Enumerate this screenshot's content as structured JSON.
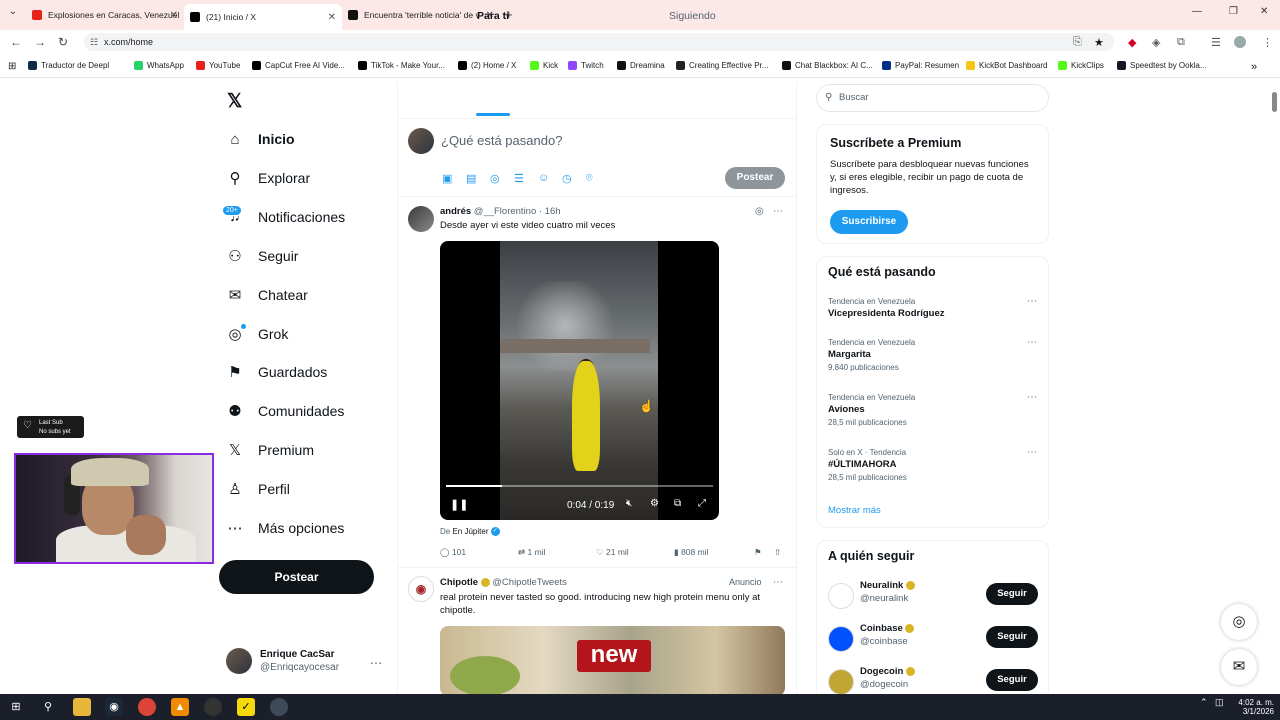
{
  "browser": {
    "tabs": [
      {
        "title": "Explosiones en Caracas, Venezuel",
        "color": "#e62117",
        "active": false
      },
      {
        "title": "(21) Inicio / X",
        "color": "#000000",
        "active": true
      },
      {
        "title": "Encuentra 'terrible noticia' de v",
        "color": "#111111",
        "active": false
      }
    ],
    "url": "x.com/home",
    "bookmarks": [
      {
        "label": "Traductor de Deepl",
        "color": "#0f2b46"
      },
      {
        "label": "WhatsApp",
        "color": "#25d366"
      },
      {
        "label": "YouTube",
        "color": "#e62117"
      },
      {
        "label": "CapCut Free AI Vide...",
        "color": "#000000"
      },
      {
        "label": "TikTok - Make Your...",
        "color": "#000000"
      },
      {
        "label": "(2) Home / X",
        "color": "#000000"
      },
      {
        "label": "Kick",
        "color": "#53fc18"
      },
      {
        "label": "Twitch",
        "color": "#9146ff"
      },
      {
        "label": "Dreamina",
        "color": "#111111"
      },
      {
        "label": "Creating Effective Pr...",
        "color": "#222222"
      },
      {
        "label": "Chat Blackbox: AI C...",
        "color": "#111111"
      },
      {
        "label": "PayPal: Resumen",
        "color": "#003087"
      },
      {
        "label": "KickBot Dashboard",
        "color": "#f5c518"
      },
      {
        "label": "KickClips",
        "color": "#53fc18"
      },
      {
        "label": "Speedtest by Ookla...",
        "color": "#141526"
      }
    ]
  },
  "nav": {
    "items": [
      {
        "label": "Inicio",
        "icon": "home-icon",
        "glyph": "⌂"
      },
      {
        "label": "Explorar",
        "icon": "search-icon",
        "glyph": "⚲"
      },
      {
        "label": "Notificaciones",
        "icon": "bell-icon",
        "glyph": "♫"
      },
      {
        "label": "Seguir",
        "icon": "add-user-icon",
        "glyph": "⚇"
      },
      {
        "label": "Chatear",
        "icon": "mail-icon",
        "glyph": "✉"
      },
      {
        "label": "Grok",
        "icon": "grok-icon",
        "glyph": "◎"
      },
      {
        "label": "Guardados",
        "icon": "bookmark-icon",
        "glyph": "⚑"
      },
      {
        "label": "Comunidades",
        "icon": "communities-icon",
        "glyph": "⚉"
      },
      {
        "label": "Premium",
        "icon": "x-logo-icon",
        "glyph": "𝕏"
      },
      {
        "label": "Perfil",
        "icon": "profile-icon",
        "glyph": "♙"
      },
      {
        "label": "Más opciones",
        "icon": "more-options-icon",
        "glyph": "⋯"
      }
    ],
    "notif_badge": "20+",
    "post_button": "Postear",
    "account": {
      "name": "Enrique CacSar",
      "handle": "@Enriqcayocesar"
    }
  },
  "overlay": {
    "last_sub_title": "Last Sub",
    "last_sub_value": "No subs yet"
  },
  "feed": {
    "tabs": [
      "Para ti",
      "Siguiendo"
    ],
    "compose_placeholder": "¿Qué está pasando?",
    "compose_post": "Postear",
    "tweet": {
      "name": "andrés",
      "handle": "@__Florentino",
      "time": "16h",
      "text": "Desde ayer vi este video cuatro mil veces",
      "video_time": "0:04 / 0:19",
      "video_progress": 0.21,
      "via_prefix": "De",
      "via_source": "En Júpiter",
      "replies": "101",
      "reposts": "1 mil",
      "likes": "21 mil",
      "views": "808 mil"
    },
    "ad": {
      "name": "Chipotle",
      "handle": "@ChipotleTweets",
      "label": "Anuncio",
      "text": "real protein never tasted so good. introducing new high protein menu only at chipotle.",
      "image_tag": "new"
    }
  },
  "sidebar": {
    "search_placeholder": "Buscar",
    "premium": {
      "title": "Suscríbete a Premium",
      "text": "Suscríbete para desbloquear nuevas funciones y, si eres elegible, recibir un pago de cuota de ingresos.",
      "button": "Suscribirse"
    },
    "trends_title": "Qué está pasando",
    "trends": [
      {
        "context": "Tendencia en Venezuela",
        "title": "Vicepresidenta Rodríguez",
        "count": ""
      },
      {
        "context": "Tendencia en Venezuela",
        "title": "Margarita",
        "count": "9.840 publicaciones"
      },
      {
        "context": "Tendencia en Venezuela",
        "title": "Aviones",
        "count": "28,5 mil publicaciones"
      },
      {
        "context": "Solo en X · Tendencia",
        "title": "#ÚLTIMAHORA",
        "count": "28,5 mil publicaciones"
      }
    ],
    "show_more": "Mostrar más",
    "follow_title": "A quién seguir",
    "follow": [
      {
        "name": "Neuralink",
        "handle": "@neuralink",
        "button": "Seguir",
        "color": "#ffffff"
      },
      {
        "name": "Coinbase",
        "handle": "@coinbase",
        "button": "Seguir",
        "color": "#0052ff"
      },
      {
        "name": "Dogecoin",
        "handle": "@dogecoin",
        "button": "Seguir",
        "color": "#c2a633"
      }
    ]
  },
  "taskbar": {
    "time": "4:02 a. m.",
    "date": "3/1/2026"
  }
}
